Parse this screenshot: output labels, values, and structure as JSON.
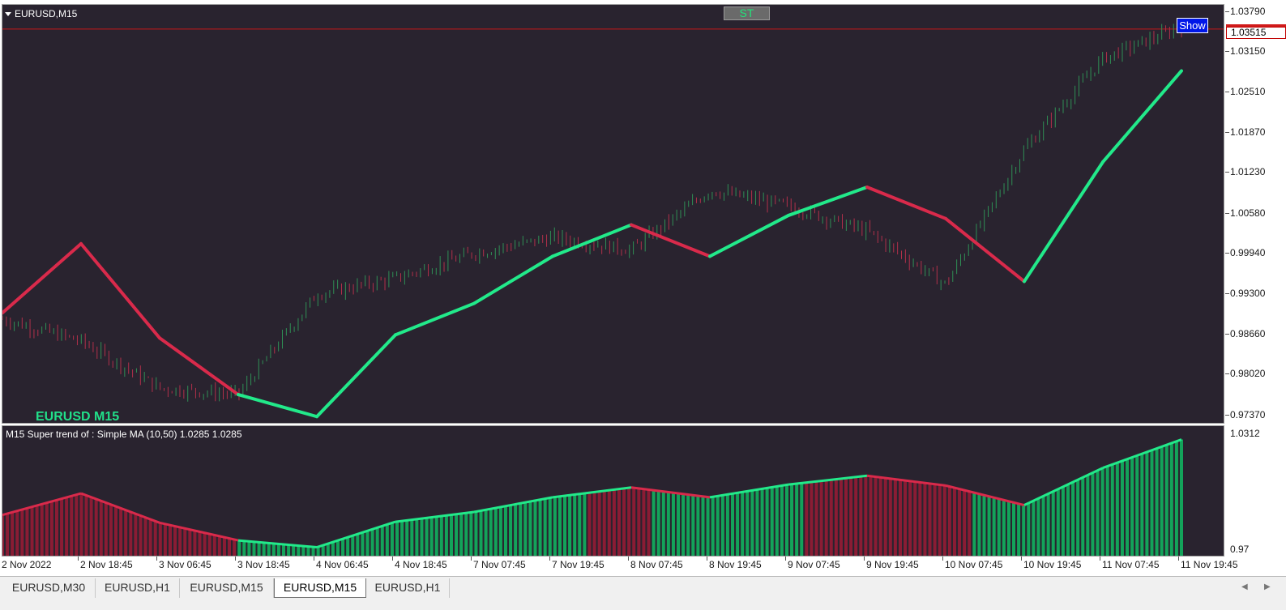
{
  "chart_title": "EURUSD,M15",
  "st_button_label": "ST",
  "show_button_label": "Show",
  "symbol_label": "EURUSD M15",
  "indicator_title": "M15  Super trend of :  Simple MA (10,50)  1.0285 1.0285",
  "current_price": "1.03515",
  "colors": {
    "background": "#29232f",
    "uptrend": "#22e98a",
    "downtrend": "#d92a4b",
    "up_fill": "#13a35a",
    "down_fill": "#8a1c34",
    "bid_line": "#c91919"
  },
  "price_axis": [
    "1.03790",
    "1.03150",
    "1.02510",
    "1.01870",
    "1.01230",
    "1.00580",
    "0.99940",
    "0.99300",
    "0.98660",
    "0.98020",
    "0.97370"
  ],
  "indicator_axis": [
    "1.0312",
    "0.97"
  ],
  "time_axis": [
    "2 Nov 2022",
    "2 Nov 18:45",
    "3 Nov 06:45",
    "3 Nov 18:45",
    "4 Nov 06:45",
    "4 Nov 18:45",
    "7 Nov 07:45",
    "7 Nov 19:45",
    "8 Nov 07:45",
    "8 Nov 19:45",
    "9 Nov 07:45",
    "9 Nov 19:45",
    "10 Nov 07:45",
    "10 Nov 19:45",
    "11 Nov 07:45",
    "11 Nov 19:45"
  ],
  "tabs": [
    {
      "label": "EURUSD,M30",
      "active": false
    },
    {
      "label": "EURUSD,H1",
      "active": false
    },
    {
      "label": "EURUSD,M15",
      "active": false
    },
    {
      "label": "EURUSD,M15",
      "active": true
    },
    {
      "label": "EURUSD,H1",
      "active": false
    }
  ],
  "chart_data": {
    "type": "line",
    "title": "EURUSD,M15",
    "x": [
      "2 Nov 2022",
      "2 Nov 18:45",
      "3 Nov 06:45",
      "3 Nov 18:45",
      "4 Nov 06:45",
      "4 Nov 18:45",
      "7 Nov 07:45",
      "7 Nov 19:45",
      "8 Nov 07:45",
      "8 Nov 19:45",
      "9 Nov 07:45",
      "9 Nov 19:45",
      "10 Nov 07:45",
      "10 Nov 19:45",
      "11 Nov 07:45",
      "11 Nov 19:45"
    ],
    "ylim": [
      0.9725,
      1.039
    ],
    "series": [
      {
        "name": "EURUSD",
        "values": [
          0.989,
          0.9855,
          0.978,
          0.977,
          0.993,
          0.9955,
          0.9995,
          1.002,
          1.0,
          1.0095,
          1.007,
          1.003,
          0.9945,
          1.016,
          1.0305,
          1.0355
        ]
      },
      {
        "values": [
          0.99,
          1.001,
          0.986,
          0.977,
          0.9735,
          0.9865,
          0.9915,
          0.999,
          1.004,
          0.999,
          1.0055,
          1.01,
          1.005,
          0.995,
          1.014,
          1.0285
        ]
      }
    ]
  }
}
